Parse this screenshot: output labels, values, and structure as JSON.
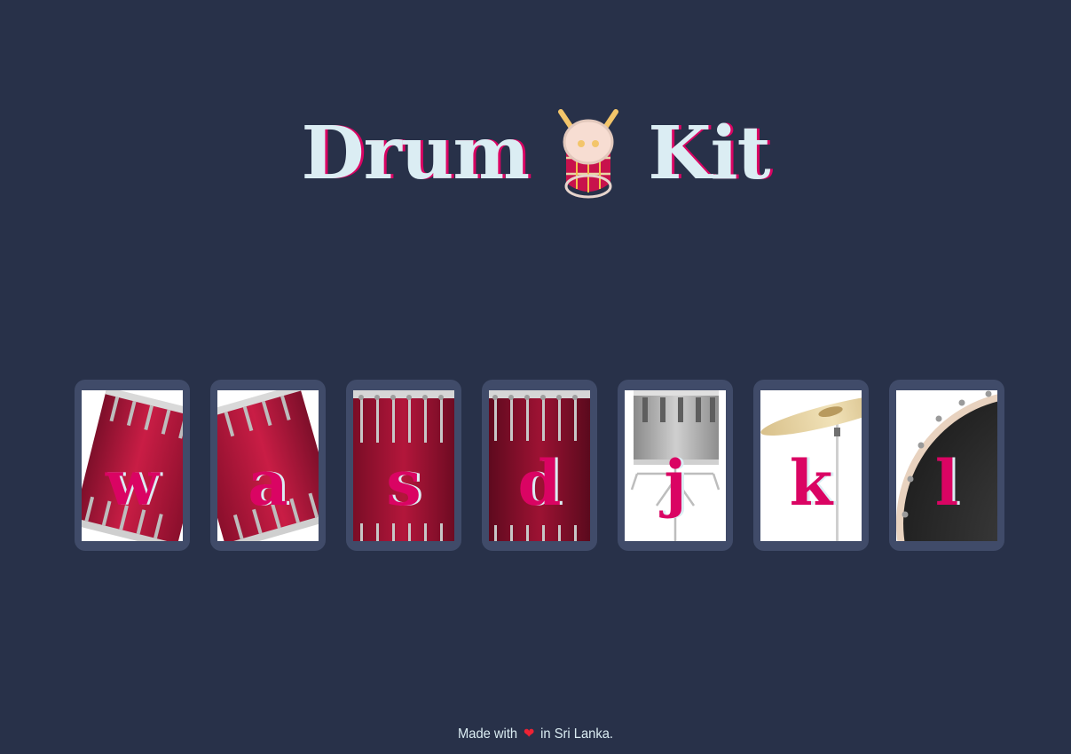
{
  "title": {
    "word_left": "Drum",
    "word_right": "Kit",
    "icon": "drum-with-sticks-icon"
  },
  "drums": [
    {
      "key": "w",
      "kind": "tom-tilted-left"
    },
    {
      "key": "a",
      "kind": "tom-tilted-right"
    },
    {
      "key": "s",
      "kind": "snare-red"
    },
    {
      "key": "d",
      "kind": "floor-tom-red"
    },
    {
      "key": "j",
      "kind": "snare-silver"
    },
    {
      "key": "k",
      "kind": "crash-cymbal"
    },
    {
      "key": "l",
      "kind": "bass-drum"
    }
  ],
  "footer": {
    "before": "Made with",
    "heart_icon": "heart-icon",
    "after": "in Sri Lanka."
  },
  "colors": {
    "background": "#283149",
    "panel": "#404B69",
    "accent": "#DA0463",
    "text": "#DBEDF3"
  }
}
